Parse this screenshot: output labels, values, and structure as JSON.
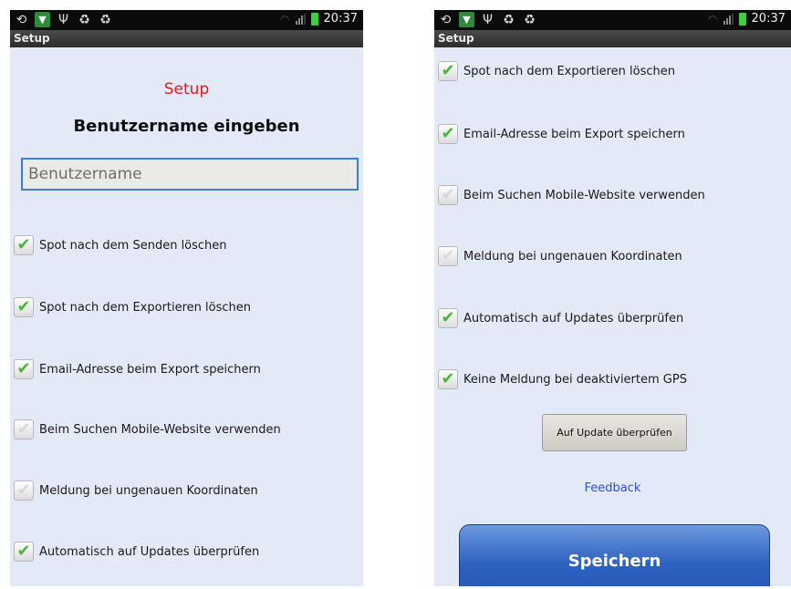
{
  "status_bar": {
    "time": "20:37"
  },
  "left_screen": {
    "title": "Setup",
    "heading": "Setup",
    "subheading": "Benutzername eingeben",
    "username_input": {
      "placeholder": "Benutzername",
      "value": ""
    },
    "options": [
      {
        "label": "Spot nach dem Senden löschen",
        "checked": true
      },
      {
        "label": "Spot nach dem Exportieren löschen",
        "checked": true
      },
      {
        "label": "Email-Adresse beim Export speichern",
        "checked": true
      },
      {
        "label": "Beim Suchen Mobile-Website verwenden",
        "checked": false
      },
      {
        "label": "Meldung bei ungenauen Koordinaten",
        "checked": false
      },
      {
        "label": "Automatisch auf Updates überprüfen",
        "checked": true
      }
    ]
  },
  "right_screen": {
    "title": "Setup",
    "options": [
      {
        "label": "Spot nach dem Exportieren löschen",
        "checked": true
      },
      {
        "label": "Email-Adresse beim Export speichern",
        "checked": true
      },
      {
        "label": "Beim Suchen Mobile-Website verwenden",
        "checked": false
      },
      {
        "label": "Meldung bei ungenauen Koordinaten",
        "checked": false
      },
      {
        "label": "Automatisch auf Updates überprüfen",
        "checked": true
      },
      {
        "label": "Keine Meldung bei deaktiviertem GPS",
        "checked": true
      }
    ],
    "update_button": "Auf Update überprüfen",
    "feedback_link": "Feedback",
    "save_button": "Speichern"
  },
  "colors": {
    "heading_red": "#e41b17",
    "link_blue": "#2a50d0",
    "check_green": "#48b83a",
    "background": "#e4e9f7"
  }
}
